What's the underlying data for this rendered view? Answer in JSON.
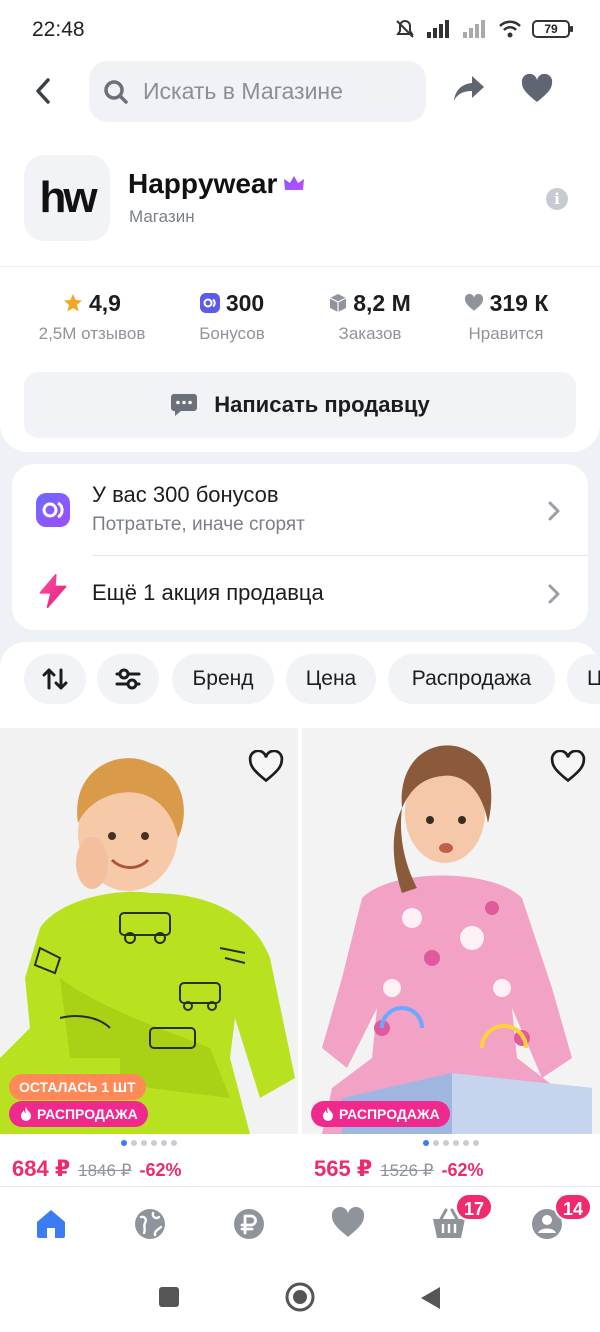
{
  "status_bar": {
    "time": "22:48",
    "battery": "79"
  },
  "search": {
    "placeholder": "Искать в Магазине"
  },
  "store": {
    "logo_text": "hw",
    "name": "Happywear",
    "type": "Магазин"
  },
  "stats": [
    {
      "value": "4,9",
      "label": "2,5М отзывов",
      "icon": "star-icon",
      "color": "#f5a623"
    },
    {
      "value": "300",
      "label": "Бонусов",
      "icon": "bonus-icon",
      "color": "#5b5bf0"
    },
    {
      "value": "8,2 М",
      "label": "Заказов",
      "icon": "box-icon",
      "color": "#8f949c"
    },
    {
      "value": "319 К",
      "label": "Нравится",
      "icon": "heart-icon",
      "color": "#8f949c"
    }
  ],
  "message_button": {
    "label": "Написать продавцу"
  },
  "promos": {
    "bonus_title": "У вас 300 бонусов",
    "bonus_subtitle": "Потратьте, иначе сгорят",
    "action_title": "Ещё 1 акция продавца"
  },
  "filters": {
    "chips": [
      "Бренд",
      "Цена",
      "Распродажа",
      "Ц"
    ]
  },
  "products": [
    {
      "badge_left": "ОСТАЛАСЬ 1 ШТ",
      "badge_sale": "РАСПРОДАЖА",
      "price": "684 ₽",
      "old_price": "1846 ₽",
      "discount": "-62%"
    },
    {
      "badge_sale": "РАСПРОДАЖА",
      "price": "565 ₽",
      "old_price": "1526 ₽",
      "discount": "-62%"
    }
  ],
  "bottom_nav": {
    "cart_count": "17",
    "profile_count": "14"
  },
  "colors": {
    "accent": "#3d7bf0",
    "sale": "#ef2a8c",
    "price": "#ef2a6d"
  }
}
